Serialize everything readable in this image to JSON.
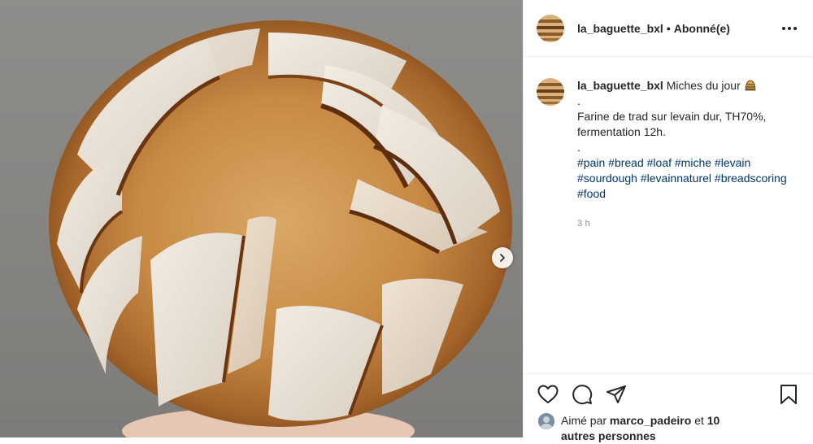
{
  "post": {
    "username": "la_baguette_bxl",
    "separator": "•",
    "follow_status": "Abonné(e)",
    "more_label": "More options"
  },
  "caption": {
    "username": "la_baguette_bxl",
    "title": "Miches du jour",
    "emoji": "bread-emoji",
    "line_dot1": ".",
    "body": "Farine de trad sur levain dur, TH70%, fermentation 12h.",
    "line_dot2": ".",
    "hashtags": [
      "#pain",
      "#bread",
      "#loaf",
      "#miche",
      "#levain",
      "#sourdough",
      "#levainnaturel",
      "#breadscoring",
      "#food"
    ],
    "time": "3 h"
  },
  "actions": {
    "like_icon": "heart-icon",
    "comment_icon": "comment-icon",
    "share_icon": "paper-plane-icon",
    "save_icon": "bookmark-icon"
  },
  "likes": {
    "prefix": "Aimé par",
    "liker": "marco_padeiro",
    "conj": "et",
    "others": "10 autres personnes"
  },
  "media": {
    "next_icon": "chevron-right-icon"
  }
}
